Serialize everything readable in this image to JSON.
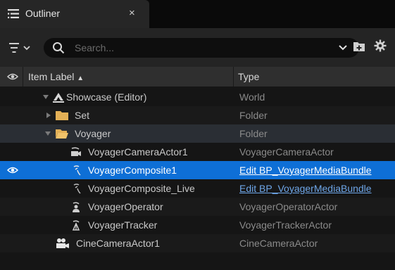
{
  "tab": {
    "title": "Outliner",
    "close_glyph": "×"
  },
  "toolbar": {
    "search_placeholder": "Search...",
    "icons": [
      "filter-icon",
      "search-icon",
      "chevron-down-icon",
      "add-folder-icon",
      "gear-icon"
    ]
  },
  "header": {
    "label": "Item Label",
    "sort_glyph": "▲",
    "type": "Type"
  },
  "colors": {
    "selection": "#0e6fd6",
    "link": "#6ea6e8",
    "folder": "#e3b056",
    "panel": "#151515"
  },
  "rows": [
    {
      "label": "Showcase (Editor)",
      "type": "World",
      "icon": "world-icon",
      "expanded": true
    },
    {
      "label": "Set",
      "type": "Folder",
      "icon": "folder-icon",
      "expanded": false
    },
    {
      "label": "Voyager",
      "type": "Folder",
      "icon": "folder-open-icon",
      "expanded": true
    },
    {
      "label": "VoyagerCameraActor1",
      "type": "VoyagerCameraActor",
      "icon": "camera-actor-icon"
    },
    {
      "label": "VoyagerComposite1",
      "type": "Edit BP_VoyagerMediaBundle",
      "icon": "composite-icon",
      "selected": true,
      "visible": true
    },
    {
      "label": "VoyagerComposite_Live",
      "type": "Edit BP_VoyagerMediaBundle",
      "icon": "composite-icon"
    },
    {
      "label": "VoyagerOperator",
      "type": "VoyagerOperatorActor",
      "icon": "operator-icon"
    },
    {
      "label": "VoyagerTracker",
      "type": "VoyagerTrackerActor",
      "icon": "tracker-icon"
    },
    {
      "label": "CineCameraActor1",
      "type": "CineCameraActor",
      "icon": "cine-camera-icon"
    }
  ]
}
